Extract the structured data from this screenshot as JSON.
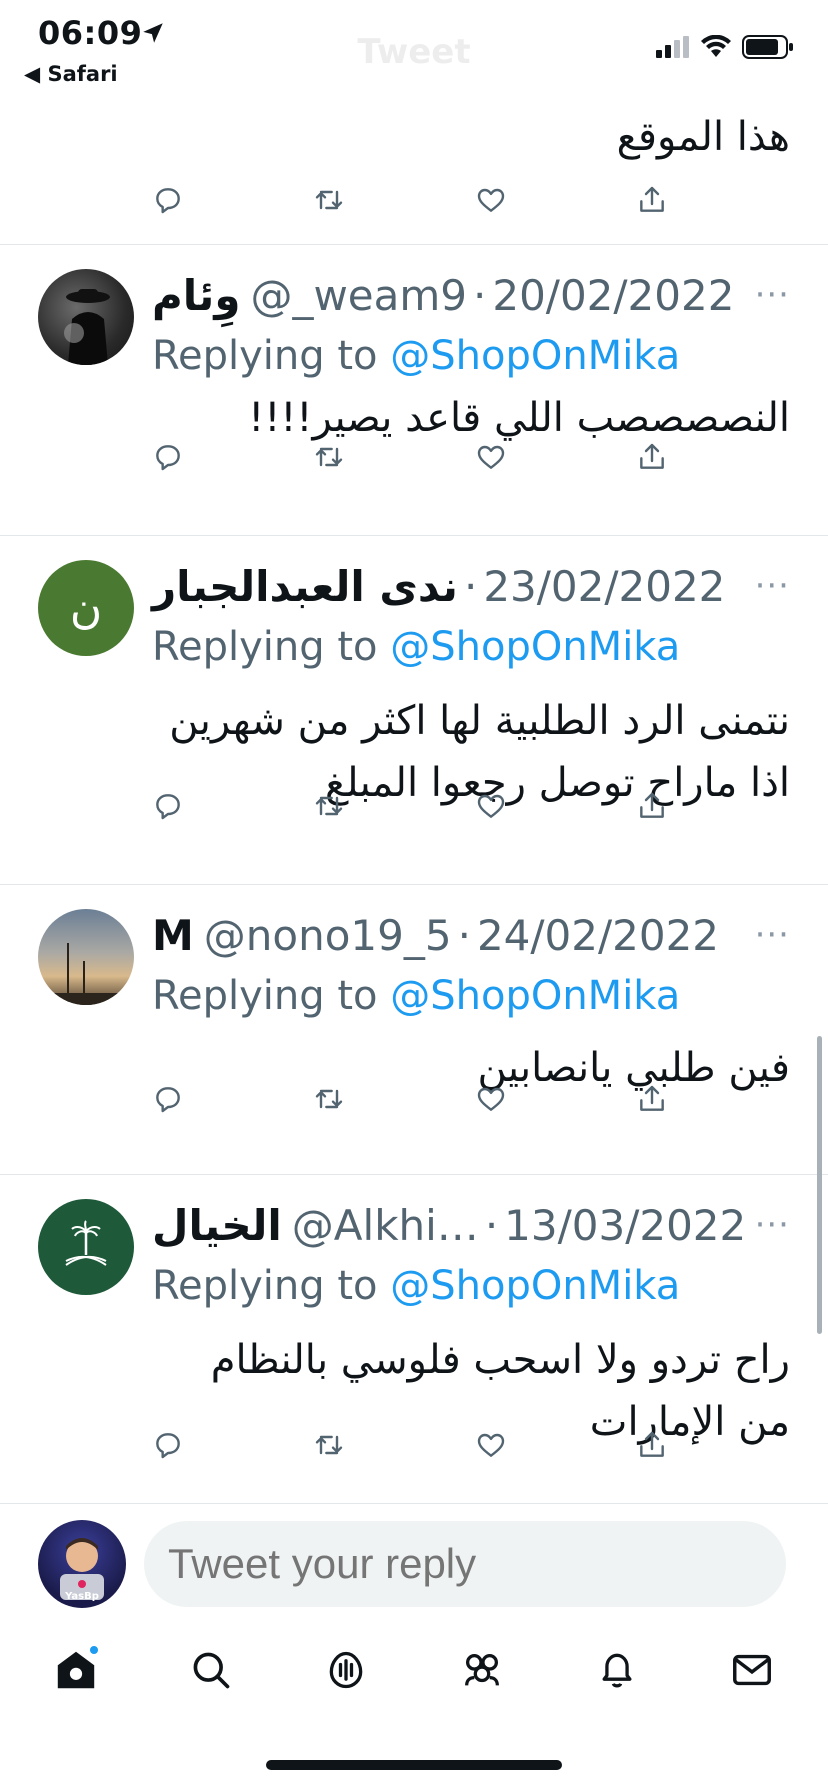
{
  "status_bar": {
    "time": "06:09",
    "back_app": "Safari",
    "title": "Tweet"
  },
  "colors": {
    "accent": "#1d9bf0",
    "secondary_text": "#536471",
    "primary_text": "#0f1419"
  },
  "top_partial_tweet": {
    "text": "هذا الموقع"
  },
  "tweets": [
    {
      "name": "وِئام",
      "handle": "@_weam9",
      "date": "20/02/2022",
      "replying_label": "Replying to",
      "replying_to": "@ShopOnMika",
      "text": "النصصصصب اللي قاعد يصير!!!!",
      "avatar": "dark-photo-avatar"
    },
    {
      "name": "ندى العبدالجبار",
      "handle": "",
      "date": "23/02/2022",
      "replying_label": "Replying to",
      "replying_to": "@ShopOnMika",
      "text": "نتمنى الرد الطلبية لها اكثر من شهرين\nاذا ماراح توصل رجعوا المبلغ",
      "avatar_letter": "ن",
      "avatar_color": "#4a7a31"
    },
    {
      "name": "M",
      "handle": "@nono19_5",
      "date": "24/02/2022",
      "replying_label": "Replying to",
      "replying_to": "@ShopOnMika",
      "text": "فين طلبي يانصابين",
      "avatar": "sky-photo-avatar"
    },
    {
      "name": "الخيال",
      "handle": "@Alkhi…",
      "date": "13/03/2022",
      "replying_label": "Replying to",
      "replying_to": "@ShopOnMika",
      "text": "راح تردو ولا اسحب فلوسي بالنظام\nمن الإمارات",
      "avatar": "saudi-emblem-avatar",
      "avatar_color": "#1e5a3a"
    }
  ],
  "composer": {
    "placeholder": "Tweet your reply",
    "avatar_tag": "YasBp"
  },
  "tabs": [
    "home",
    "search",
    "spaces",
    "communities",
    "notifications",
    "messages"
  ]
}
